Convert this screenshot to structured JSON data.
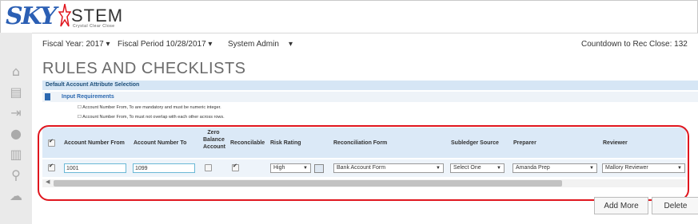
{
  "logo": {
    "brand_a": "SKY",
    "brand_b": "STEM",
    "tagline": "Crystal Clear Close"
  },
  "topbar": {
    "fiscal_year": "Fiscal Year: 2017 ▾",
    "fiscal_period": "Fiscal Period  10/28/2017 ▾",
    "user": "System Admin",
    "user_arrow": "▾",
    "countdown": "Countdown to Rec Close: 132"
  },
  "page_title": "RULES AND CHECKLISTS",
  "section_title": "Default Account Attribute Selection",
  "input_requirements": {
    "label": "Input Requirements",
    "items": [
      "☐ Account Number From, To are mandatory and must be numeric integer.",
      "☐ Account Number From, To must not overlap with each other across rows."
    ]
  },
  "table": {
    "headers": {
      "acct_from": "Account Number From",
      "acct_to": "Account Number To",
      "zero_balance": [
        "Zero",
        "Balance",
        "Account"
      ],
      "reconcilable": "Reconcilable",
      "risk_rating": "Risk Rating",
      "recon_form": "Reconciliation Form",
      "subledger": "Subledger Source",
      "preparer": "Preparer",
      "reviewer": "Reviewer"
    },
    "row": {
      "acct_from": "1001",
      "acct_to": "1099",
      "risk_rating": "High",
      "recon_form": "Bank Account Form",
      "subledger": "Select One",
      "preparer": "Amanda Prep",
      "reviewer": "Mallory Reviewer"
    }
  },
  "buttons": {
    "add_more": "Add More",
    "delete": "Delete"
  },
  "colors": {
    "accent": "#2b5fb4",
    "highlight": "#e0161e"
  }
}
